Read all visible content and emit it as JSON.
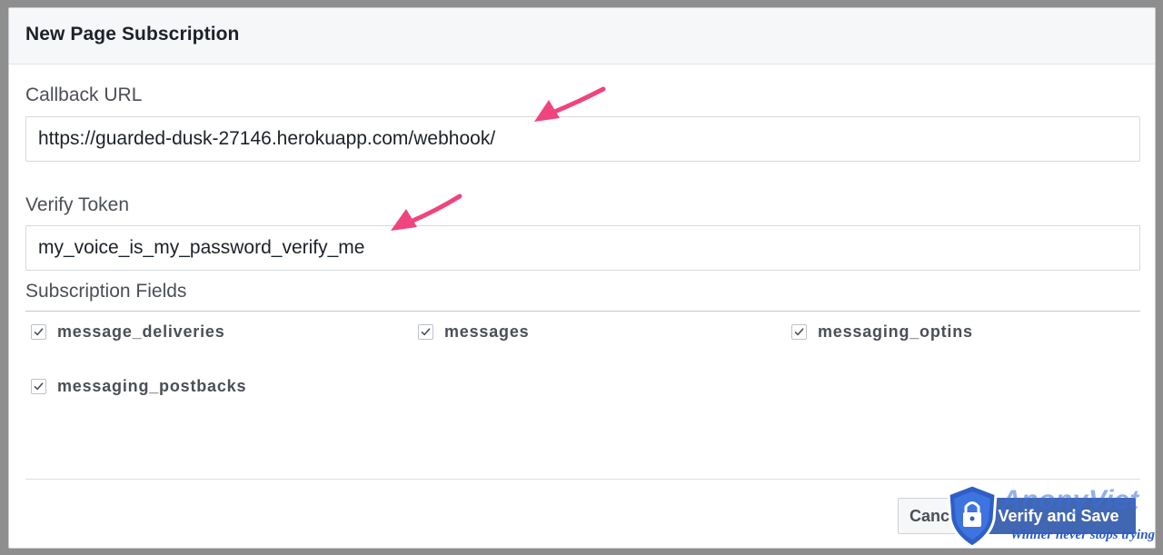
{
  "dialog": {
    "title": "New Page Subscription"
  },
  "callback": {
    "label": "Callback URL",
    "value": "https://guarded-dusk-27146.herokuapp.com/webhook/"
  },
  "verify_token": {
    "label": "Verify Token",
    "value": "my_voice_is_my_password_verify_me"
  },
  "subscription_fields": {
    "label": "Subscription Fields",
    "items": [
      {
        "label": "message_deliveries",
        "checked": true
      },
      {
        "label": "messages",
        "checked": true
      },
      {
        "label": "messaging_optins",
        "checked": true
      },
      {
        "label": "messaging_postbacks",
        "checked": true
      }
    ]
  },
  "footer": {
    "cancel_label": "Cancel",
    "verify_save_label": "Verify and Save"
  },
  "annotations": {
    "arrow_color": "#f0447e",
    "arrow_icon": "pink-pointer-arrow-icon"
  },
  "watermark": {
    "brand": "AnonyViet",
    "tagline": "Winner never stops trying",
    "icon": "lock-shield-icon"
  },
  "colors": {
    "primary_button": "#4267b2",
    "header_bg": "#f6f7f9"
  }
}
